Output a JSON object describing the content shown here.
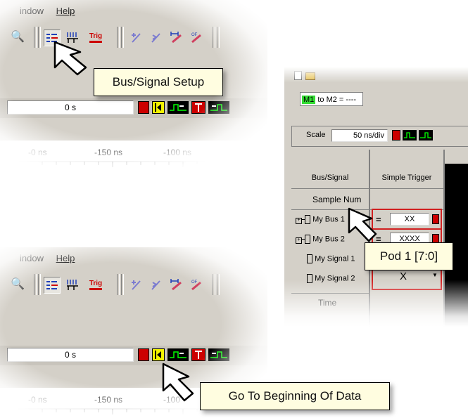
{
  "top_panel": {
    "menu": {
      "window": "indow",
      "help": "Help"
    },
    "toolbar_icons": [
      "bus-signal-setup-icon",
      "edges-icon",
      "trig-icon",
      "marker-add-icon",
      "marker-next-icon",
      "measure-icon",
      "offset-icon"
    ],
    "trig_label": "Trig",
    "time_value": "0 s",
    "ruler": {
      "t1": "-0 ns",
      "t2": "-150 ns",
      "t3": "-100 ns"
    },
    "callout": "Bus/Signal Setup"
  },
  "right_panel": {
    "marker_m1": "M1",
    "marker_to": "to",
    "marker_m2": "M2 = ----",
    "scale_label": "Scale",
    "scale_value": "50 ns/div",
    "col_bus_signal": "Bus/Signal",
    "col_simple_trigger": "Simple Trigger",
    "sample_num": "Sample Num",
    "rows": [
      {
        "name": "My Bus 1",
        "op": "=",
        "value": "XX"
      },
      {
        "name": "My Bus 2",
        "op": "=",
        "value": "XXXX"
      },
      {
        "name": "My Signal 1",
        "op": "",
        "value": ""
      },
      {
        "name": "My Signal 2",
        "op": "",
        "value": "X"
      }
    ],
    "time_label": "Time",
    "callout": "Pod 1 [7:0]"
  },
  "bottom_panel": {
    "menu": {
      "window": "indow",
      "help": "Help"
    },
    "trig_label": "Trig",
    "time_value": "0 s",
    "ruler": {
      "t1": "-0 ns",
      "t2": "-150 ns",
      "t3": "-100"
    },
    "callout": "Go To Beginning Of Data"
  },
  "colors": {
    "window_bg": "#d4d0c8",
    "callout_bg": "#fffde0",
    "marker_green": "#33dd33",
    "trigger_red": "#cc0000",
    "go_begin_yellow": "#f3f300"
  }
}
